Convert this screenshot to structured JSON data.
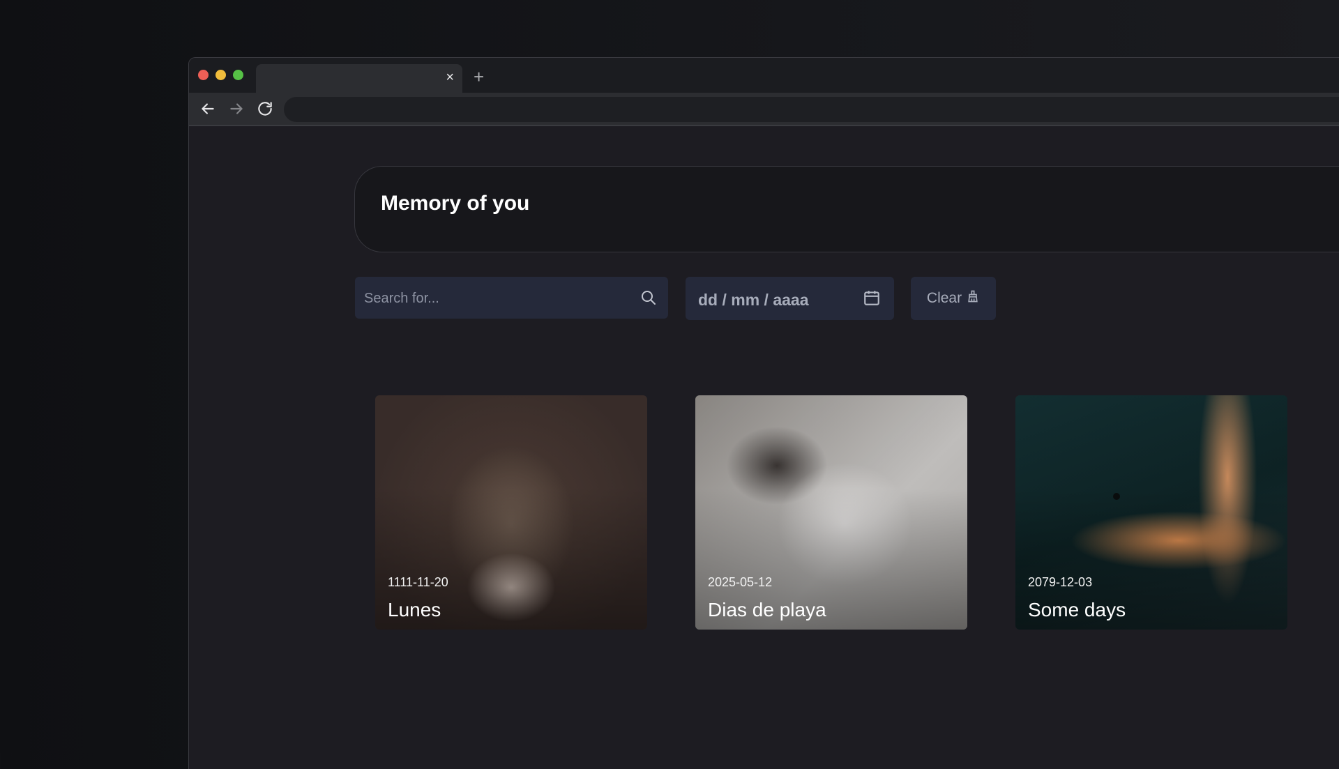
{
  "browser": {
    "tab_close": "×",
    "new_tab": "+"
  },
  "header": {
    "title": "Memory of you"
  },
  "filters": {
    "search_placeholder": "Search for...",
    "date_placeholder": "dd / mm / aaaa",
    "clear_label": "Clear"
  },
  "cards": [
    {
      "date": "1111-11-20",
      "title": "Lunes",
      "image": "kitten-photo"
    },
    {
      "date": "2025-05-12",
      "title": "Dias de playa",
      "image": "cat-photo"
    },
    {
      "date": "2079-12-03",
      "title": "Some days",
      "image": "space-photo"
    }
  ],
  "colors": {
    "page_bg": "#1d1c22",
    "input_bg": "#25293a",
    "header_bg": "#17171b"
  }
}
